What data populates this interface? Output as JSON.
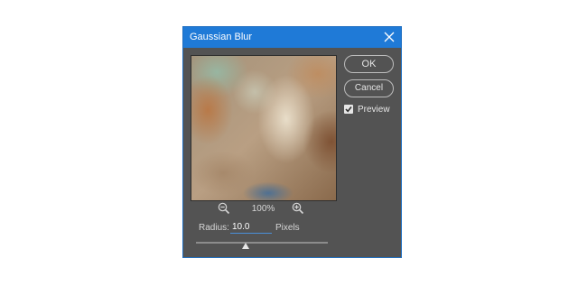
{
  "dialog": {
    "title": "Gaussian Blur",
    "buttons": {
      "ok_label": "OK",
      "cancel_label": "Cancel"
    },
    "preview_checkbox": {
      "label": "Preview",
      "checked": true
    },
    "zoom": {
      "level": "100%"
    },
    "radius": {
      "label": "Radius:",
      "value": "10.0",
      "unit": "Pixels",
      "slider_fraction": 0.38
    }
  },
  "icons": [
    "close-icon",
    "zoom-out-icon",
    "zoom-in-icon",
    "checkmark-icon"
  ],
  "colors": {
    "titlebar": "#1f7ad7",
    "dialog_bg": "#535353",
    "input_underline": "#4a90d9"
  }
}
